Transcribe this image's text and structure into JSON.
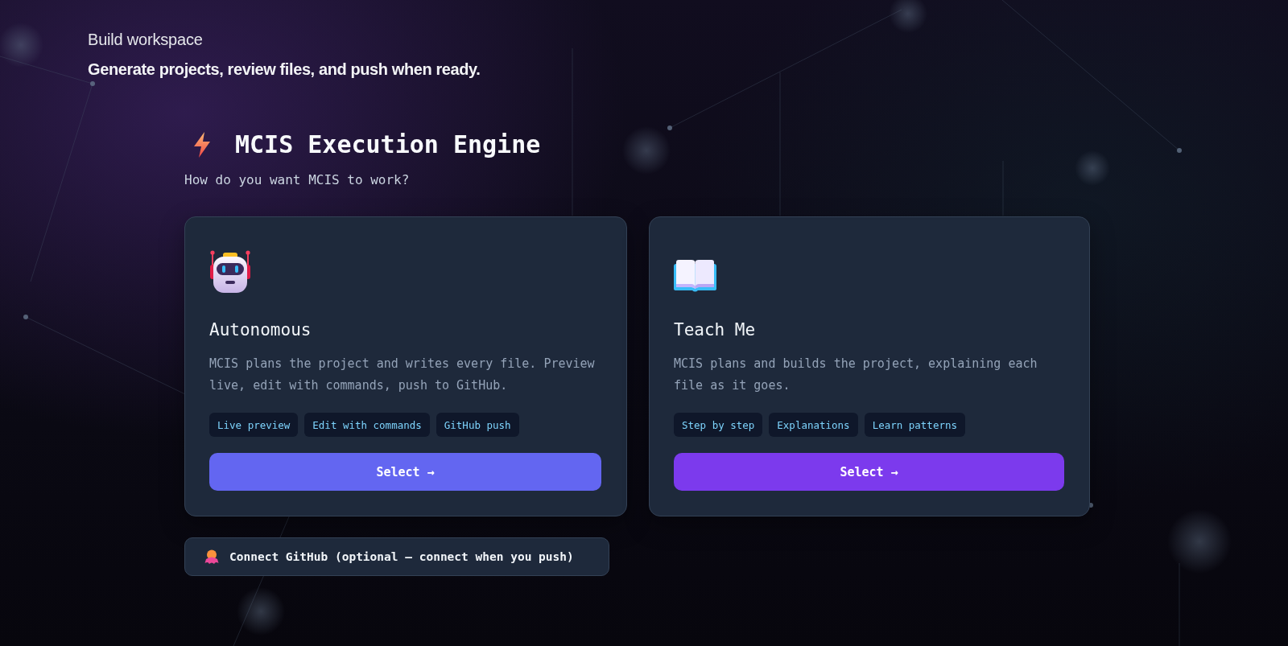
{
  "header": {
    "title": "Build workspace",
    "subtitle": "Generate projects, review files, and push when ready."
  },
  "engine": {
    "title": "MCIS Execution Engine",
    "prompt": "How do you want MCIS to work?"
  },
  "modes": [
    {
      "title": "Autonomous",
      "description": "MCIS plans the project and writes every file. Preview live, edit with commands, push to GitHub.",
      "tags": [
        "Live preview",
        "Edit with commands",
        "GitHub push"
      ],
      "button": "Select →",
      "color": "#6366f1"
    },
    {
      "title": "Teach Me",
      "description": "MCIS plans and builds the project, explaining each file as it goes.",
      "tags": [
        "Step by step",
        "Explanations",
        "Learn patterns"
      ],
      "button": "Select →",
      "color": "#7c3aed"
    }
  ],
  "github_button": {
    "label": "Connect GitHub (optional — connect when you push)"
  }
}
